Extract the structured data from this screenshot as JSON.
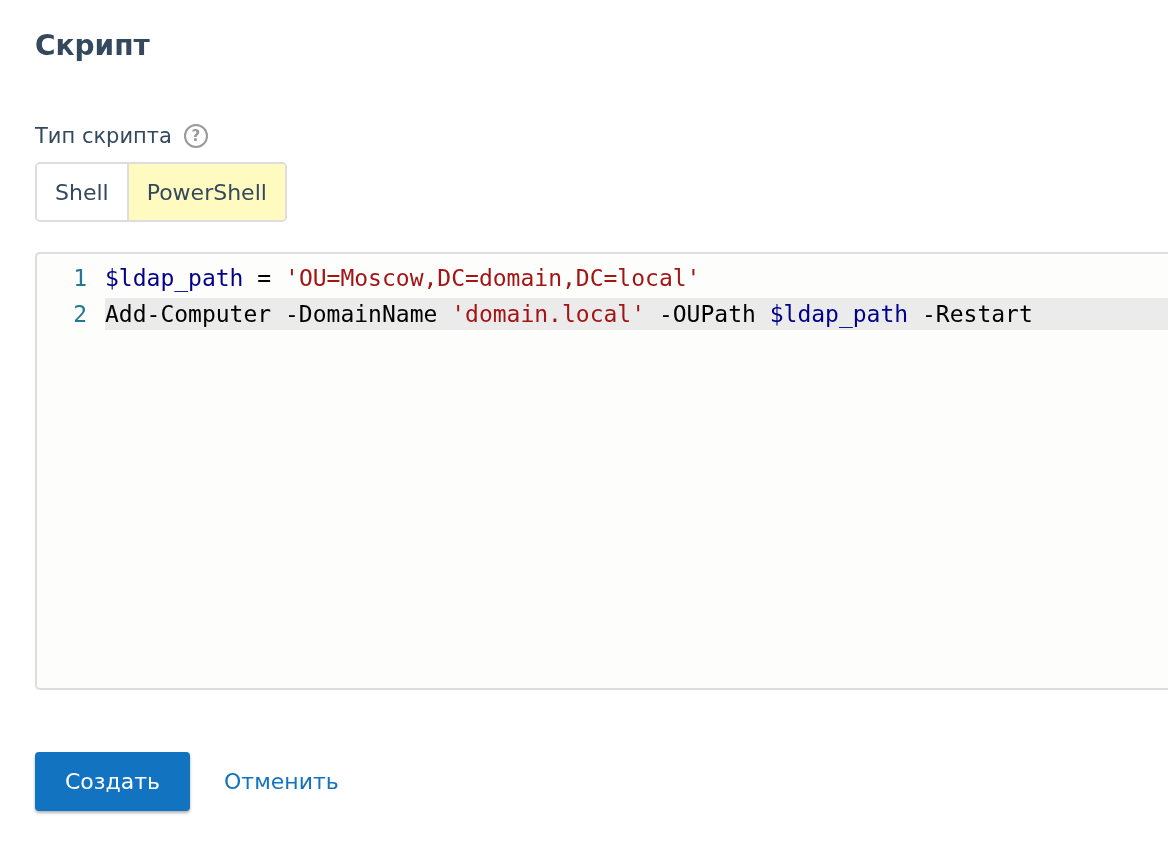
{
  "title": "Скрипт",
  "script_type": {
    "label": "Тип скрипта",
    "help_icon": "?",
    "options": [
      {
        "label": "Shell",
        "selected": false
      },
      {
        "label": "PowerShell",
        "selected": true
      }
    ]
  },
  "editor": {
    "lines": [
      {
        "number": "1",
        "active": false,
        "tokens": [
          {
            "kind": "variable",
            "text": "$ldap_path"
          },
          {
            "kind": "plain",
            "text": " = "
          },
          {
            "kind": "string",
            "text": "'OU=Moscow,DC=domain,DC=local'"
          }
        ]
      },
      {
        "number": "2",
        "active": true,
        "tokens": [
          {
            "kind": "plain",
            "text": "Add-Computer -DomainName "
          },
          {
            "kind": "string",
            "text": "'domain.local'"
          },
          {
            "kind": "plain",
            "text": " -OUPath "
          },
          {
            "kind": "variable",
            "text": "$ldap_path"
          },
          {
            "kind": "plain",
            "text": " -Restart"
          }
        ]
      }
    ]
  },
  "buttons": {
    "create": "Создать",
    "cancel": "Отменить"
  }
}
